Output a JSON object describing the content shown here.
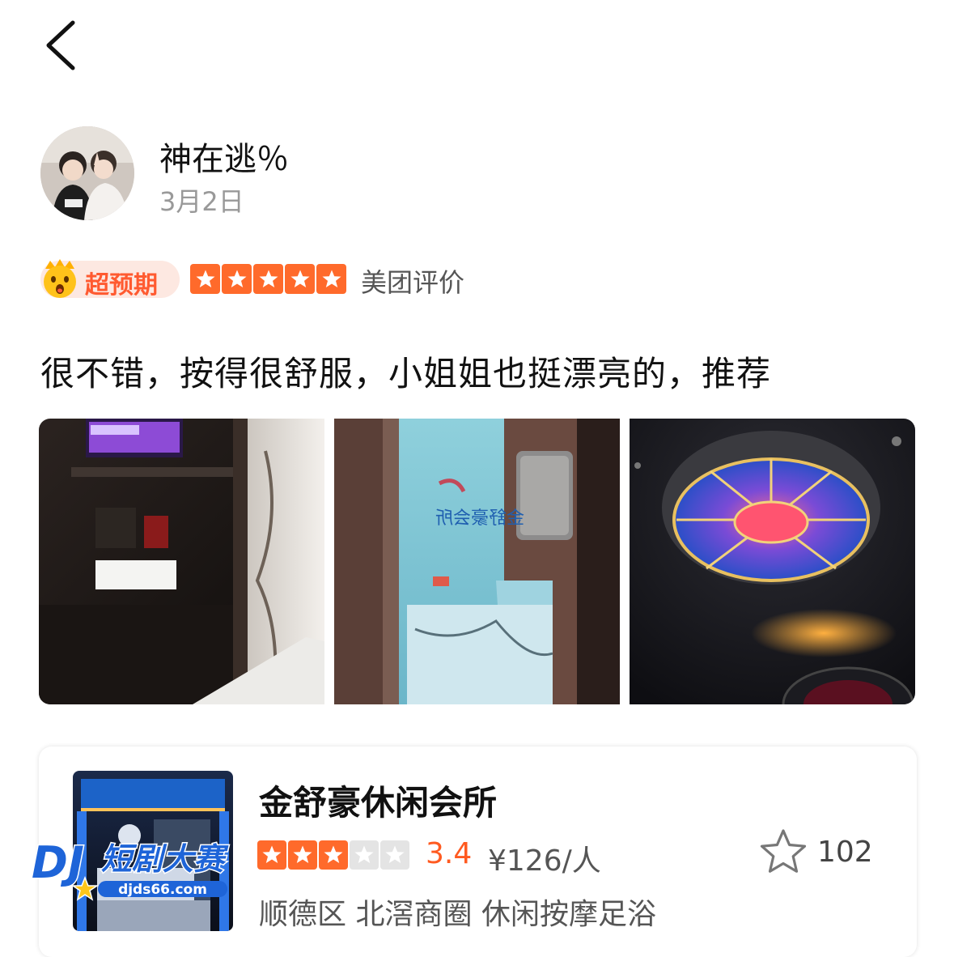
{
  "nav": {
    "back_icon": "chevron-left-icon"
  },
  "author": {
    "username": "神在逃％",
    "date": "3月2日"
  },
  "rating": {
    "badge_label": "超预期",
    "stars": 5,
    "star_color": "#ff6a2b",
    "source": "美团评价"
  },
  "review": {
    "text": "很不错，按得很舒服，小姐姐也挺漂亮的，推荐"
  },
  "photos": {
    "sign_text": "金舒豪会所",
    "count_shown": 3
  },
  "shop": {
    "name": "金舒豪休闲会所",
    "stars": 3,
    "score": "3.4",
    "price": "¥126/人",
    "favorites": "102",
    "district": "顺德区",
    "business_area": "北滘商圈",
    "category": "休闲按摩足浴",
    "accent_color": "#ff5a20"
  },
  "watermark": {
    "brand": "短剧大赛",
    "url": "djds66.com"
  }
}
